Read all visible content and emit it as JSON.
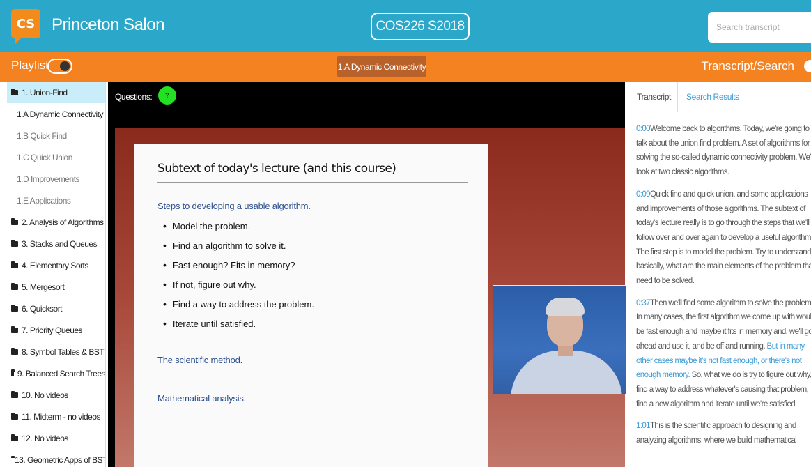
{
  "header": {
    "logo": "CS",
    "app_title": "Princeton Salon",
    "course": "COS226 S2018",
    "search_placeholder": "Search transcript"
  },
  "toolbar": {
    "playlist_label": "Playlist",
    "current_section": "1.A Dynamic Connectivity",
    "transcript_link": "Transcript/Search"
  },
  "sidebar": {
    "items": [
      {
        "label": "1. Union-Find",
        "type": "section"
      },
      {
        "label": "1.A Dynamic Connectivity",
        "type": "sub"
      },
      {
        "label": "1.B Quick Find",
        "type": "sub"
      },
      {
        "label": "1.C Quick Union",
        "type": "sub"
      },
      {
        "label": "1.D Improvements",
        "type": "sub"
      },
      {
        "label": "1.E Applications",
        "type": "sub"
      },
      {
        "label": "2. Analysis of Algorithms",
        "type": "section"
      },
      {
        "label": "3. Stacks and Queues",
        "type": "section"
      },
      {
        "label": "4. Elementary Sorts",
        "type": "section"
      },
      {
        "label": "5. Mergesort",
        "type": "section"
      },
      {
        "label": "6. Quicksort",
        "type": "section"
      },
      {
        "label": "7. Priority Queues",
        "type": "section"
      },
      {
        "label": "8. Symbol Tables & BST",
        "type": "section"
      },
      {
        "label": "9. Balanced Search Trees",
        "type": "section"
      },
      {
        "label": "10. No videos",
        "type": "section"
      },
      {
        "label": "11. Midterm - no videos",
        "type": "section"
      },
      {
        "label": "12. No videos",
        "type": "section"
      },
      {
        "label": "13. Geometric Apps of BST",
        "type": "section"
      }
    ]
  },
  "video": {
    "questions_label": "Questions:",
    "questions_badge": "?",
    "slide": {
      "title": "Subtext of today's lecture (and this course)",
      "heading1": "Steps to developing a usable algorithm.",
      "bullets": [
        "Model the problem.",
        "Find an algorithm to solve it.",
        "Fast enough? Fits in memory?",
        "If not, figure out why.",
        "Find a way to address the problem.",
        "Iterate until satisfied."
      ],
      "heading2": "The scientific method.",
      "heading3": "Mathematical analysis."
    }
  },
  "panel": {
    "tab_transcript": "Transcript",
    "tab_results": "Search Results",
    "paragraphs": [
      {
        "time": "0:00",
        "lines": [
          "Welcome back to algorithms. Today, we're going to",
          "talk about the union find problem. A set of algorithms for",
          "solving the so-called dynamic connectivity problem. We'll",
          "look at two classic algorithms."
        ]
      },
      {
        "time": "0:09",
        "lines": [
          "Quick find and quick union, and some applications",
          "and improvements of those algorithms. The subtext of",
          "today's lecture really is to go through the steps that we'll",
          "follow over and over again to develop a useful algorithm.",
          "The first step is to model the problem. Try to understand,",
          "basically, what are the main elements of the problem that",
          "need to be solved."
        ]
      },
      {
        "time": "0:37",
        "lines": [
          "Then we'll find some algorithm to solve the problem.",
          "In many cases, the first algorithm we come up with would",
          "be fast enough and maybe it fits in memory and, we'll go",
          "ahead and use it, and be off and running."
        ],
        "highlight": [
          "But in many",
          "other cases maybe it's not fast enough, or there's not",
          "enough memory."
        ],
        "after": [
          "So, what we do is try to figure out why,",
          "find a way to address whatever's causing that problem,",
          "find a new algorithm and iterate until we're satisfied."
        ]
      },
      {
        "time": "1:01",
        "lines": [
          "This is the scientific approach to designing and",
          "analyzing algorithms, where we build mathematical"
        ]
      }
    ]
  },
  "colors": {
    "header_bg": "#2aa7c9",
    "toolbar_bg": "#f58220",
    "accent_link": "#3a9bd5",
    "active_section_bg": "#c9eef9",
    "questions_badge": "#22e022"
  }
}
